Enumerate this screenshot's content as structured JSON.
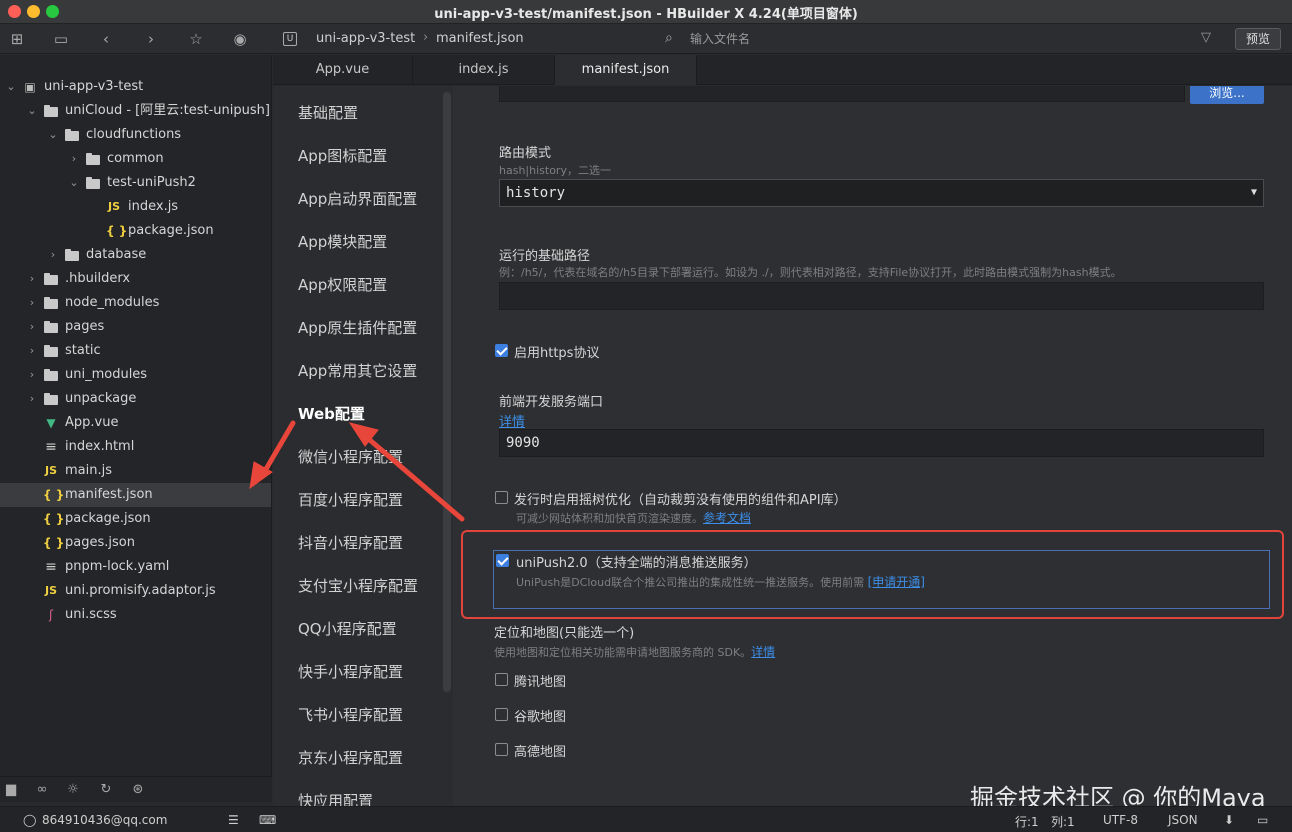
{
  "window": {
    "title": "uni-app-v3-test/manifest.json - HBuilder X 4.24(单项目窗体)"
  },
  "toolbar": {
    "breadcrumb": [
      "uni-app-v3-test",
      "manifest.json"
    ],
    "search_placeholder": "输入文件名",
    "preview_label": "预览"
  },
  "tree": [
    {
      "label": "uni-app-v3-test",
      "depth": 0,
      "kind": "project",
      "expanded": true
    },
    {
      "label": "uniCloud - [阿里云:test-unipush]",
      "depth": 1,
      "kind": "folder",
      "expanded": true
    },
    {
      "label": "cloudfunctions",
      "depth": 2,
      "kind": "folder",
      "expanded": true
    },
    {
      "label": "common",
      "depth": 3,
      "kind": "folder",
      "expanded": false
    },
    {
      "label": "test-uniPush2",
      "depth": 3,
      "kind": "folder",
      "expanded": true
    },
    {
      "label": "index.js",
      "depth": 4,
      "kind": "js"
    },
    {
      "label": "package.json",
      "depth": 4,
      "kind": "json"
    },
    {
      "label": "database",
      "depth": 2,
      "kind": "folder",
      "expanded": false
    },
    {
      "label": ".hbuilderx",
      "depth": 1,
      "kind": "folder",
      "expanded": false
    },
    {
      "label": "node_modules",
      "depth": 1,
      "kind": "folder",
      "expanded": false
    },
    {
      "label": "pages",
      "depth": 1,
      "kind": "folder",
      "expanded": false
    },
    {
      "label": "static",
      "depth": 1,
      "kind": "folder",
      "expanded": false
    },
    {
      "label": "uni_modules",
      "depth": 1,
      "kind": "folder",
      "expanded": false
    },
    {
      "label": "unpackage",
      "depth": 1,
      "kind": "folder",
      "expanded": false
    },
    {
      "label": "App.vue",
      "depth": 1,
      "kind": "vue"
    },
    {
      "label": "index.html",
      "depth": 1,
      "kind": "html"
    },
    {
      "label": "main.js",
      "depth": 1,
      "kind": "js"
    },
    {
      "label": "manifest.json",
      "depth": 1,
      "kind": "json",
      "selected": true
    },
    {
      "label": "package.json",
      "depth": 1,
      "kind": "json"
    },
    {
      "label": "pages.json",
      "depth": 1,
      "kind": "json"
    },
    {
      "label": "pnpm-lock.yaml",
      "depth": 1,
      "kind": "yaml"
    },
    {
      "label": "uni.promisify.adaptor.js",
      "depth": 1,
      "kind": "js"
    },
    {
      "label": "uni.scss",
      "depth": 1,
      "kind": "scss"
    }
  ],
  "tabs": [
    {
      "label": "App.vue",
      "active": false
    },
    {
      "label": "index.js",
      "active": false
    },
    {
      "label": "manifest.json",
      "active": true
    }
  ],
  "config_nav": [
    {
      "label": "基础配置",
      "active": false
    },
    {
      "label": "App图标配置",
      "active": false
    },
    {
      "label": "App启动界面配置",
      "active": false
    },
    {
      "label": "App模块配置",
      "active": false
    },
    {
      "label": "App权限配置",
      "active": false
    },
    {
      "label": "App原生插件配置",
      "active": false
    },
    {
      "label": "App常用其它设置",
      "active": false
    },
    {
      "label": "Web配置",
      "active": true
    },
    {
      "label": "微信小程序配置",
      "active": false
    },
    {
      "label": "百度小程序配置",
      "active": false
    },
    {
      "label": "抖音小程序配置",
      "active": false
    },
    {
      "label": "支付宝小程序配置",
      "active": false
    },
    {
      "label": "QQ小程序配置",
      "active": false
    },
    {
      "label": "快手小程序配置",
      "active": false
    },
    {
      "label": "飞书小程序配置",
      "active": false
    },
    {
      "label": "京东小程序配置",
      "active": false
    },
    {
      "label": "快应用配置",
      "active": false
    }
  ],
  "form": {
    "browse_label": "浏览...",
    "router_mode": {
      "label": "路由模式",
      "hint": "hash|history，二选一",
      "value": "history"
    },
    "base_path": {
      "label": "运行的基础路径",
      "hint": "例：/h5/，代表在域名的/h5目录下部署运行。如设为 ./，则代表相对路径，支持File协议打开，此时路由模式强制为hash模式。",
      "value": ""
    },
    "https": {
      "label": "启用https协议",
      "checked": true
    },
    "dev_port": {
      "label": "前端开发服务端口",
      "link": "详情",
      "value": "9090"
    },
    "treeshake": {
      "label": "发行时启用摇树优化（自动裁剪没有使用的组件和API库）",
      "hint": "可减少网站体积和加快首页渲染速度。",
      "link": "参考文档",
      "checked": false
    },
    "unipush": {
      "label": "uniPush2.0（支持全端的消息推送服务）",
      "hint": "UniPush是DCloud联合个推公司推出的集成性统一推送服务。使用前需",
      "link": "[申请开通]",
      "checked": true
    },
    "maps": {
      "label": "定位和地图(只能选一个)",
      "hint": "使用地图和定位相关功能需申请地图服务商的 SDK。",
      "link": "详情",
      "options": [
        {
          "label": "腾讯地图",
          "checked": false
        },
        {
          "label": "谷歌地图",
          "checked": false
        },
        {
          "label": "高德地图",
          "checked": false
        }
      ]
    }
  },
  "watermark": "掘金技术社区 @ 你的Maya",
  "status": {
    "account": "864910436@qq.com",
    "row": "行:1",
    "col": "列:1",
    "encoding": "UTF-8",
    "language": "JSON"
  },
  "colors": {
    "accent": "#3d7fe0",
    "highlight_frame": "#e0443a",
    "arrow": "#e8463a"
  }
}
